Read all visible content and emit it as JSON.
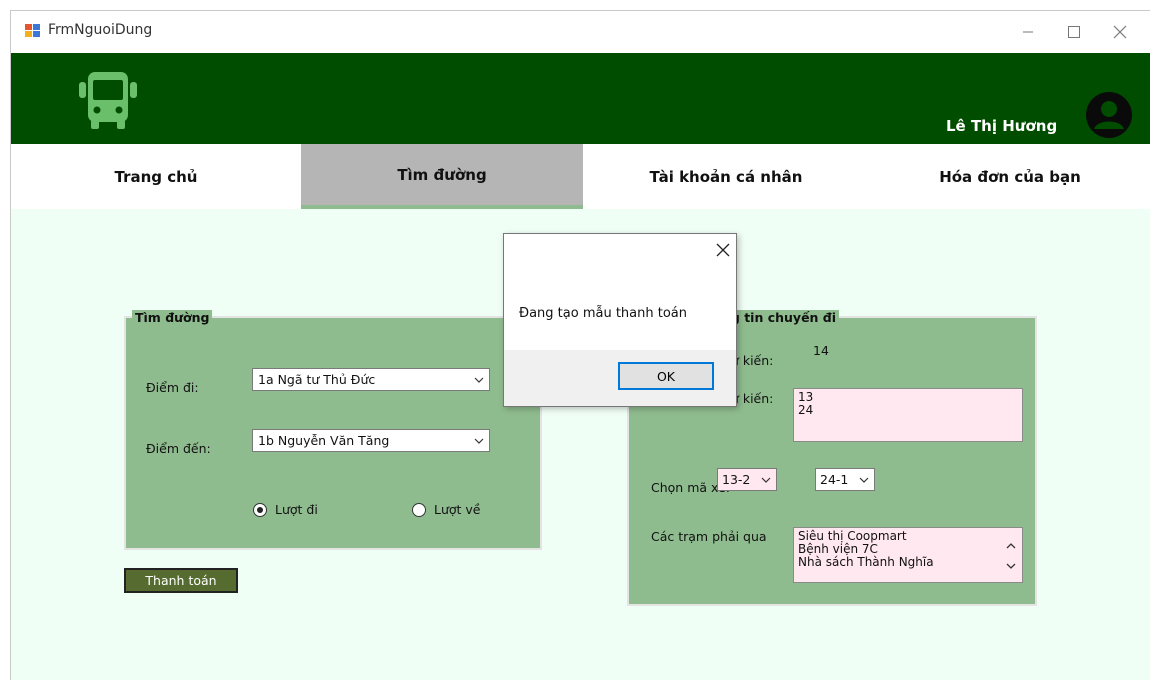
{
  "window": {
    "title": "FrmNguoiDung"
  },
  "header": {
    "user_name": "Lê Thị Hương"
  },
  "nav": {
    "tabs": [
      {
        "label": "Trang chủ",
        "active": false
      },
      {
        "label": "Tìm đường",
        "active": true
      },
      {
        "label": "Tài khoản cá nhân",
        "active": false
      },
      {
        "label": "Hóa đơn của bạn",
        "active": false
      }
    ]
  },
  "route_panel": {
    "legend": "Tìm đường",
    "from_label": "Điểm đi:",
    "from_value": "1a Ngã tư Thủ Đức",
    "to_label": "Điểm đến:",
    "to_value": "1b Nguyễn Văn Tăng",
    "radio_go": "Lượt đi",
    "radio_return": "Lượt về",
    "selected_direction": "Lượt đi"
  },
  "trip_panel": {
    "legend_visible": "ng tin chuyến đi",
    "label1_visible": "dự kiến:",
    "value1": "14",
    "label2_visible": "dự kiến:",
    "list2_items": [
      "13",
      "24"
    ],
    "bus_code_label": "Chọn mã xe:",
    "bus_code_1": "13-2",
    "bus_code_2": "24-1",
    "stations_label": "Các trạm phải qua",
    "stations": [
      "Siêu thị Coopmart",
      "Bệnh viện 7C",
      "Nhà sách Thành Nghĩa"
    ]
  },
  "pay_button_label": "Thanh toán",
  "dialog": {
    "message": "Đang tạo mẫu thanh toán",
    "ok_label": "OK"
  },
  "colors": {
    "header_bg": "#004d00",
    "panel_bg": "#8fbc8f",
    "content_bg": "#f0fff6",
    "list_bg": "#ffe8ef",
    "button_bg": "#556b2f",
    "active_tab_bg": "#b5b5b5",
    "icon_green": "#6abf6a"
  }
}
